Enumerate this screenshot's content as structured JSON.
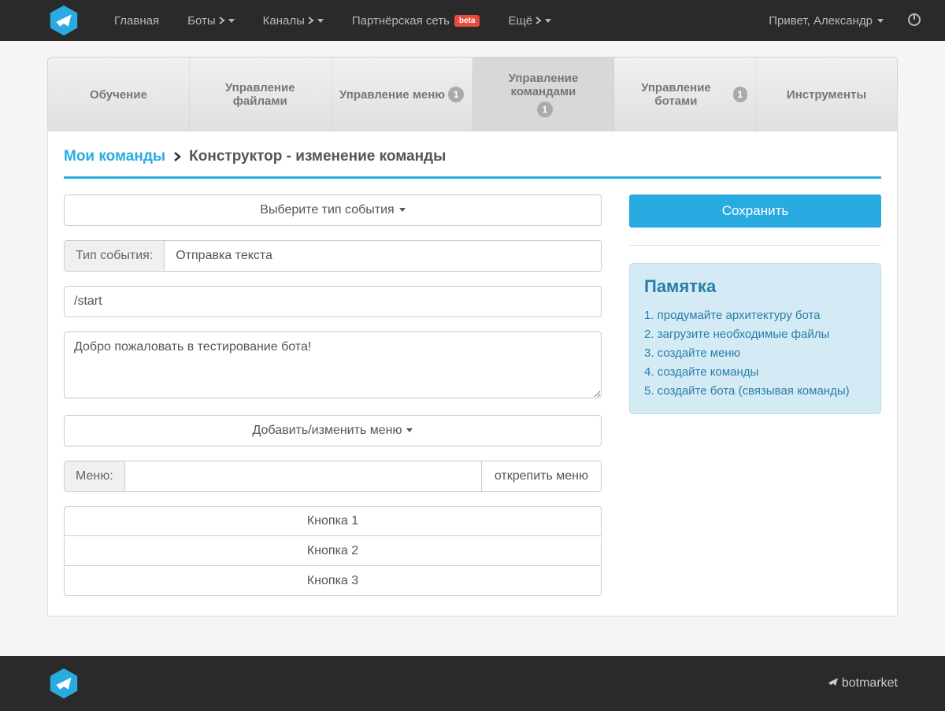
{
  "topnav": {
    "items": [
      {
        "label": "Главная"
      },
      {
        "label": "Боты"
      },
      {
        "label": "Каналы"
      },
      {
        "label": "Партнёрская сеть",
        "badge": "beta"
      },
      {
        "label": "Ещё"
      }
    ],
    "greeting": "Привет, Александр"
  },
  "tabs": [
    {
      "label": "Обучение"
    },
    {
      "label": "Управление файлами"
    },
    {
      "label": "Управление меню",
      "badge": "1"
    },
    {
      "label": "Управление командами",
      "badge": "1",
      "active": true
    },
    {
      "label": "Управление ботами",
      "badge": "1"
    },
    {
      "label": "Инструменты"
    }
  ],
  "breadcrumb": {
    "link": "Мои команды",
    "current": "Конструктор - изменение команды"
  },
  "form": {
    "event_type_dropdown": "Выберите тип события",
    "event_type_label": "Тип события:",
    "event_type_value": "Отправка текста",
    "command_value": "/start",
    "message_value": "Добро пожаловать в тестирование бота!",
    "menu_dropdown": "Добавить/изменить меню",
    "menu_label": "Меню:",
    "menu_value": "",
    "detach_button": "открепить меню",
    "buttons": [
      "Кнопка 1",
      "Кнопка 2",
      "Кнопка 3"
    ]
  },
  "sidebar": {
    "save_button": "Сохранить",
    "memo_title": "Памятка",
    "memo_items": [
      "1. продумайте архитектуру бота",
      "2. загрузите необходимые файлы",
      "3. создайте меню",
      "4. создайте команды",
      "5. создайте бота (связывая команды)"
    ]
  },
  "footer": {
    "brand": "botmarket"
  }
}
